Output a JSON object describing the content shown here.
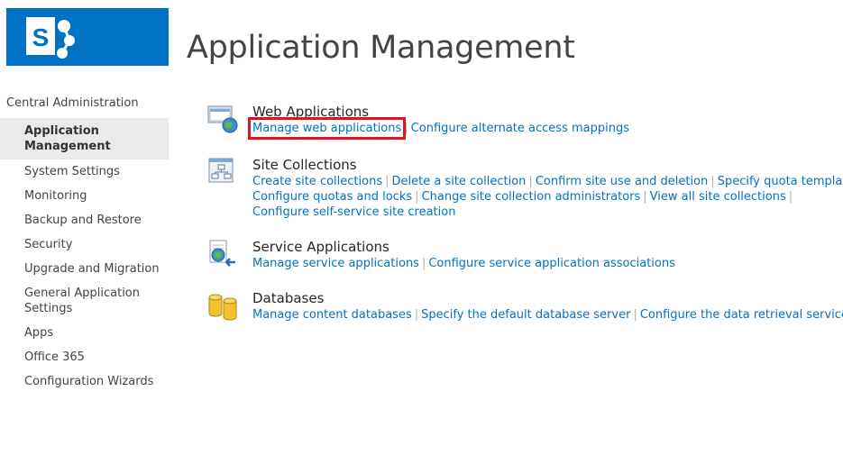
{
  "brand": {
    "color": "#0072c6",
    "logo_icon": "sharepoint-logo-icon"
  },
  "page_title": "Application Management",
  "leftnav": {
    "root": "Central Administration",
    "items": [
      "Application Management",
      "System Settings",
      "Monitoring",
      "Backup and Restore",
      "Security",
      "Upgrade and Migration",
      "General Application Settings",
      "Apps",
      "Office 365",
      "Configuration Wizards"
    ],
    "selected_index": 0
  },
  "sections": {
    "web_applications": {
      "title": "Web Applications",
      "icon": "web-applications-icon",
      "links": [
        "Manage web applications",
        "Configure alternate access mappings"
      ]
    },
    "site_collections": {
      "title": "Site Collections",
      "icon": "site-collections-icon",
      "links": [
        "Create site collections",
        "Delete a site collection",
        "Confirm site use and deletion",
        "Specify quota templates",
        "Configure quotas and locks",
        "Change site collection administrators",
        "View all site collections",
        "Configure self-service site creation"
      ]
    },
    "service_applications": {
      "title": "Service Applications",
      "icon": "service-applications-icon",
      "links": [
        "Manage service applications",
        "Configure service application associations"
      ]
    },
    "databases": {
      "title": "Databases",
      "icon": "databases-icon",
      "links": [
        "Manage content databases",
        "Specify the default database server",
        "Configure the data retrieval service"
      ]
    }
  },
  "highlight_color": "#e0141e",
  "separator": "|"
}
